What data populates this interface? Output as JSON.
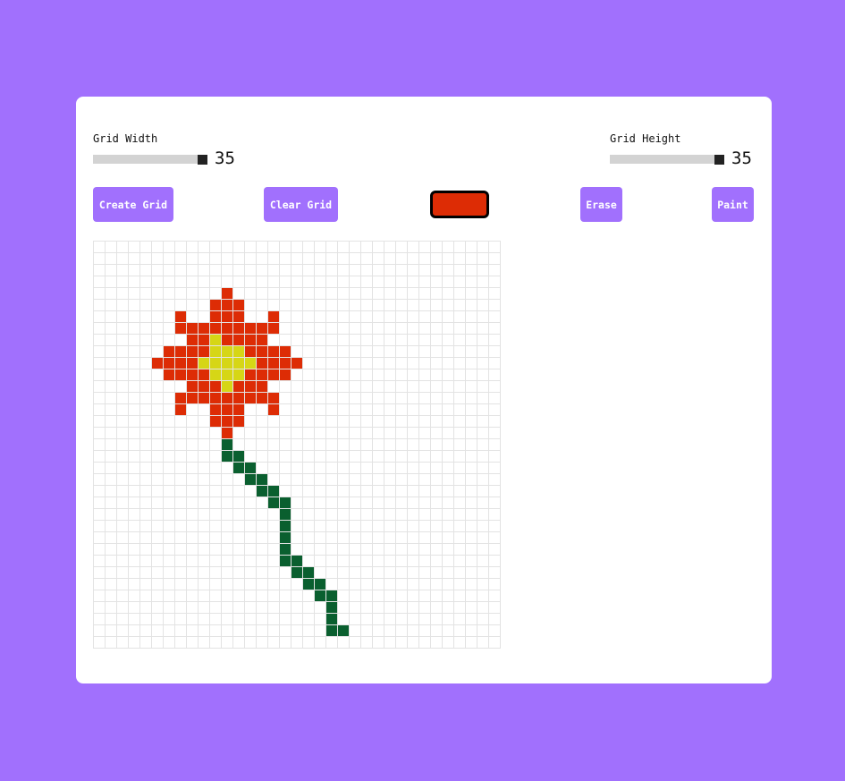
{
  "controls": {
    "grid_width": {
      "label": "Grid Width",
      "value": "35",
      "level": 35,
      "max": 35
    },
    "grid_height": {
      "label": "Grid Height",
      "value": "35",
      "level": 35,
      "max": 35
    }
  },
  "buttons": {
    "create": "Create Grid",
    "clear": "Clear Grid",
    "erase": "Erase",
    "paint": "Paint"
  },
  "colors": {
    "background": "#a170fd",
    "button": "#a170fd",
    "selected_color": "#dd2c05",
    "petal": "#dd2c05",
    "center": "#d6d616",
    "stem": "#0a5f2f",
    "cell_border": "#e3e3e3"
  },
  "grid": {
    "columns": 35,
    "rows": 35,
    "palette": {
      "R": "petal",
      "Y": "center",
      "G": "stem"
    },
    "cells": [
      "...................................",
      "...................................",
      "...................................",
      "...................................",
      "...........R.......................",
      "..........RRR......................",
      ".......R..RRR..R...................",
      ".......RRRRRRRRR...................",
      "........RRYRRRR....................",
      "......RRRRYYYRRRR..................",
      ".....RRRRYYYYYRRRR.................",
      "......RRRRYYYRRRR..................",
      "........RRRYRRR....................",
      ".......RRRRRRRRR...................",
      ".......R..RRR..R...................",
      "..........RRR......................",
      "...........R.......................",
      "...........G.......................",
      "...........GG......................",
      "............GG.....................",
      ".............GG....................",
      "..............GG...................",
      "...............GG..................",
      "................G..................",
      "................G..................",
      "................G..................",
      "................G..................",
      "................GG.................",
      ".................GG................",
      "..................GG...............",
      "...................GG..............",
      "....................G..............",
      "....................G..............",
      "....................GG.............",
      "..................................."
    ]
  }
}
